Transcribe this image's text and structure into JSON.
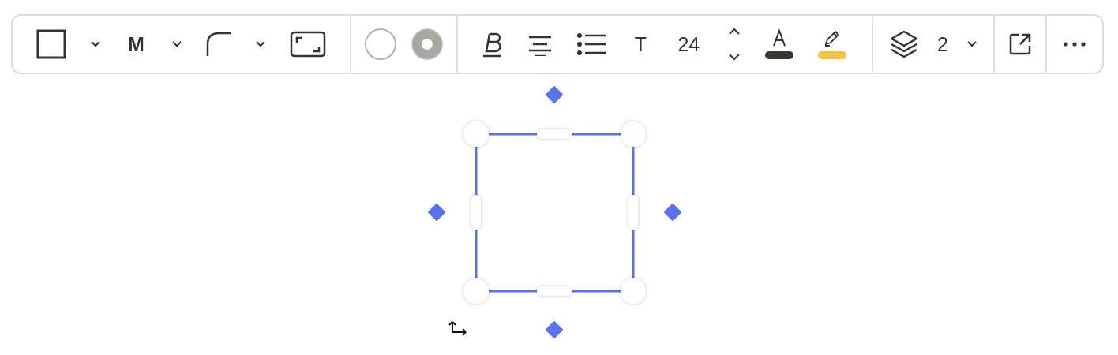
{
  "toolbar": {
    "groups": [
      {
        "items": [
          {
            "kind": "shape"
          },
          {
            "kind": "caret"
          },
          {
            "kind": "label",
            "label": "M"
          },
          {
            "kind": "caret"
          },
          {
            "kind": "corner"
          },
          {
            "kind": "caret"
          },
          {
            "kind": "frame"
          }
        ]
      },
      {
        "items": [
          {
            "kind": "stroke-none"
          },
          {
            "kind": "stroke-ring"
          }
        ]
      },
      {
        "items": [
          {
            "kind": "bold"
          },
          {
            "kind": "align"
          },
          {
            "kind": "list"
          },
          {
            "kind": "label",
            "label": "T"
          },
          {
            "kind": "label",
            "label": "24"
          },
          {
            "kind": "stepper"
          },
          {
            "kind": "text-color",
            "color": "#3a3833"
          },
          {
            "kind": "highlight",
            "color": "#f5c242"
          }
        ]
      },
      {
        "items": [
          {
            "kind": "layers"
          },
          {
            "kind": "label",
            "label": "2"
          },
          {
            "kind": "caret"
          }
        ]
      },
      {
        "items": [
          {
            "kind": "export"
          }
        ]
      },
      {
        "items": [
          {
            "kind": "more"
          }
        ]
      }
    ]
  },
  "canvas": {
    "shape": {
      "kind": "rectangle",
      "selected": true
    }
  }
}
